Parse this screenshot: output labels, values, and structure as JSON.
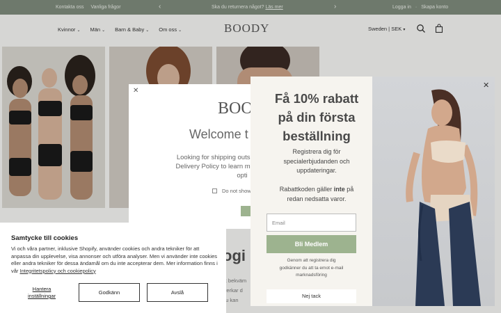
{
  "announcement": {
    "links": [
      "Kontakta oss",
      "Vanliga frågor"
    ],
    "message": "Ska du returnera något? ",
    "message_link": "Läs mer",
    "prev_icon": "chevron-left-icon",
    "next_icon": "chevron-right-icon",
    "login": "Logga in",
    "separator": "·",
    "register": "Skapa konto"
  },
  "header": {
    "nav": [
      "Kvinnor",
      "Män",
      "Barn & Baby",
      "Om oss"
    ],
    "logo": "BOODY",
    "region": "Sweden | SEK"
  },
  "welcome_popup": {
    "logo": "BOO",
    "title": "Welcome t",
    "text_lines": [
      "Looking for shipping outside",
      "Delivery Policy to learn more",
      "opti"
    ],
    "checkbox_label": "Do not show"
  },
  "background_text": {
    "heading": "ogi",
    "lines": [
      "st bekväm",
      "lverkar d",
      "du kan"
    ]
  },
  "offer_popup": {
    "title_lines": [
      "Få 10% rabatt",
      "på din första",
      "beställning"
    ],
    "subtitle_lines": [
      "Registrera dig för",
      "specialerbjudanden och",
      "uppdateringar."
    ],
    "code_before": "Rabattkoden gäller ",
    "code_bold": "inte",
    "code_after": " på",
    "code_line2": "redan nedsatta varor.",
    "email_placeholder": "Email",
    "member_button": "Bli Medlem",
    "consent_lines": [
      "Genom att registrera dig",
      "godkänner du att ta emot e-mail",
      "marknadsföring"
    ],
    "no_thanks": "Nej tack"
  },
  "cookie_banner": {
    "title": "Samtycke till cookies",
    "text": "Vi och våra partner, inklusive Shopify, använder cookies och andra tekniker för att anpassa din upplevelse, visa annonser och utföra analyser. Men vi använder inte cookies eller andra tekniker för dessa ändamål om du inte accepterar dem. Mer information finns i vår ",
    "policy_link": "Integritetspolicy och cookiepolicy",
    "manage_lines": [
      "Hantera",
      "inställningar"
    ],
    "accept": "Godkänn",
    "decline": "Avslå"
  },
  "colors": {
    "announcement_bg": "#7e8a7b",
    "accent_green": "#9db38f",
    "page_bg": "#f4f4f2",
    "offer_bg": "#f6f4ef"
  }
}
